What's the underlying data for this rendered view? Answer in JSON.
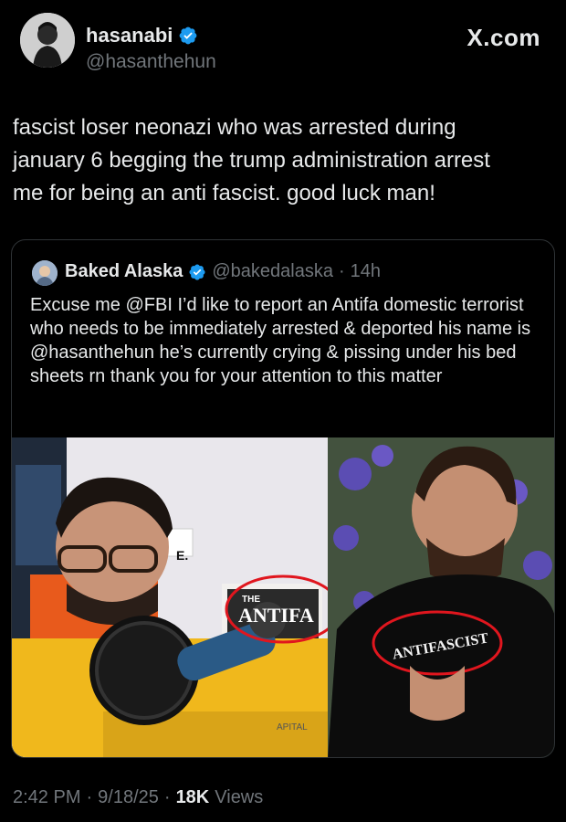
{
  "author": {
    "display_name": "hasanabi",
    "handle": "@hasanthehun",
    "verified_icon": "verified-badge-icon"
  },
  "brand": "X.com",
  "tweet": {
    "text": "fascist loser neonazi who was arrested during\njanuary 6 begging the trump administration arrest\nme for being an anti fascist. good luck man!"
  },
  "quoted": {
    "display_name": "Baked Alaska",
    "handle": "@bakedalaska",
    "separator": "·",
    "time": "14h",
    "text": "Excuse me @FBI I’d like to report an Antifa domestic terrorist who needs to be immediately arrested & deported his name is @hasanthehun he’s currently crying & pissing under his bed sheets rn thank you for your attention to this matter",
    "media": {
      "left_book_title": "ANTIFA",
      "left_book_prefix": "THE",
      "left_sign": "E.",
      "left_capital": "APITAL",
      "right_shirt_text": "ANTIFASCIST"
    }
  },
  "footer": {
    "time": "2:42 PM",
    "sep1": "·",
    "date": "9/18/25",
    "sep2": "·",
    "views_count": "18K",
    "views_label": "Views"
  },
  "colors": {
    "background": "#000000",
    "text": "#e7e9ea",
    "muted": "#71767b",
    "verified": "#1d9bf0",
    "circle": "#e0161e"
  }
}
